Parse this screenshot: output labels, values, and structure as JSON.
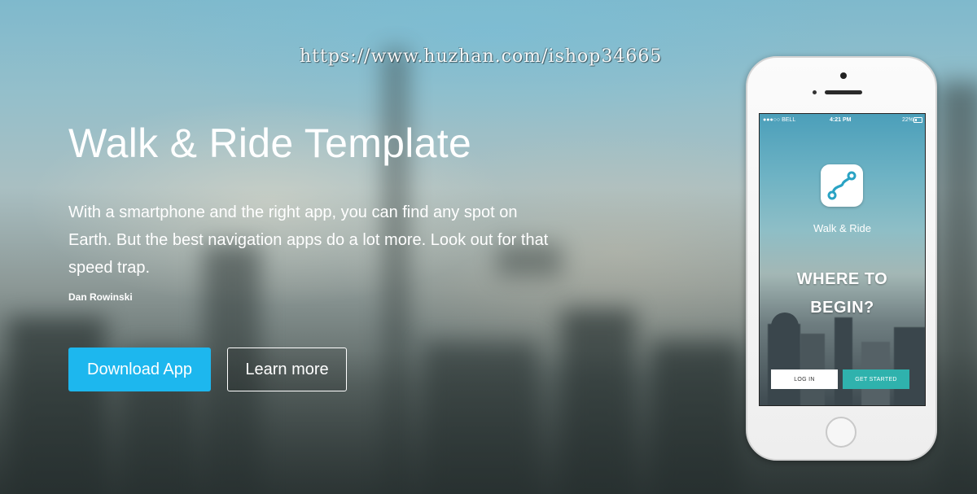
{
  "watermark": "https://www.huzhan.com/ishop34665",
  "hero": {
    "title": "Walk & Ride Template",
    "description": "With a smartphone and the right app, you can find any spot on Earth. But the best navigation apps do a lot more. Look out for that speed trap.",
    "author": "Dan Rowinski",
    "primary_button": "Download App",
    "secondary_button": "Learn more"
  },
  "phone": {
    "status": {
      "carrier": "●●●○○ BELL",
      "time": "4:21 PM",
      "battery": "22%"
    },
    "app_icon": "route-path-icon",
    "app_name": "Walk & Ride",
    "headline_line1": "WHERE TO",
    "headline_line2": "BEGIN?",
    "login_button": "LOG IN",
    "get_started_button": "GET STARTED"
  },
  "colors": {
    "primary": "#1db7ee",
    "accent_teal": "#2fb2ad"
  }
}
